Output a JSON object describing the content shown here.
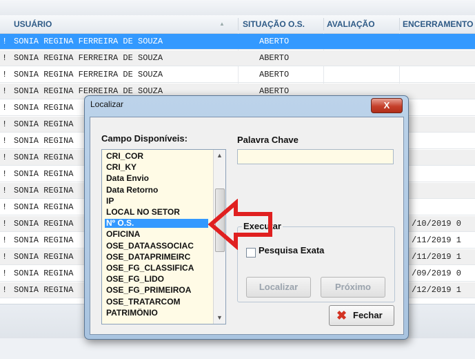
{
  "grid": {
    "columns": {
      "usuario": "USUÁRIO",
      "situacao": "SITUAÇÃO O.S.",
      "avaliacao": "AVALIAÇÃO",
      "encerramento": "ENCERRAMENTO"
    },
    "rows": [
      {
        "edge": "!",
        "usuario": "SONIA REGINA FERREIRA DE SOUZA",
        "situacao": "ABERTO",
        "encerramento": "",
        "selected": true
      },
      {
        "edge": "!",
        "usuario": "SONIA REGINA FERREIRA DE SOUZA",
        "situacao": "ABERTO",
        "encerramento": ""
      },
      {
        "edge": "!",
        "usuario": "SONIA REGINA FERREIRA DE SOUZA",
        "situacao": "ABERTO",
        "encerramento": ""
      },
      {
        "edge": "!",
        "usuario": "SONIA REGINA FERREIRA DE SOUZA",
        "situacao": "ABERTO",
        "encerramento": ""
      },
      {
        "edge": "!",
        "usuario": "SONIA REGINA",
        "situacao": "",
        "encerramento": ""
      },
      {
        "edge": "!",
        "usuario": "SONIA REGINA",
        "situacao": "",
        "encerramento": ""
      },
      {
        "edge": "!",
        "usuario": "SONIA REGINA",
        "situacao": "",
        "encerramento": ""
      },
      {
        "edge": "!",
        "usuario": "SONIA REGINA",
        "situacao": "",
        "encerramento": ""
      },
      {
        "edge": "!",
        "usuario": "SONIA REGINA",
        "situacao": "",
        "encerramento": ""
      },
      {
        "edge": "!",
        "usuario": "SONIA REGINA",
        "situacao": "",
        "encerramento": ""
      },
      {
        "edge": "!",
        "usuario": "SONIA REGINA",
        "situacao": "",
        "encerramento": ""
      },
      {
        "edge": "!",
        "usuario": "SONIA REGINA",
        "situacao": "",
        "encerramento": "/10/2019 0"
      },
      {
        "edge": "!",
        "usuario": "SONIA REGINA",
        "situacao": "",
        "encerramento": "/11/2019 1"
      },
      {
        "edge": "!",
        "usuario": "SONIA REGINA",
        "situacao": "",
        "encerramento": "/11/2019 1"
      },
      {
        "edge": "!",
        "usuario": "SONIA REGINA",
        "situacao": "",
        "encerramento": "/09/2019 0"
      },
      {
        "edge": "!",
        "usuario": "SONIA REGINA",
        "situacao": "",
        "encerramento": "/12/2019 1"
      }
    ]
  },
  "dialog": {
    "title": "Localizar",
    "close_label": "X",
    "campo_label": "Campo Disponíveis:",
    "palavra_label": "Palavra Chave",
    "palavra_value": "",
    "fields": [
      "CRI_COR",
      "CRI_KY",
      "Data Envio",
      "Data Retorno",
      "IP",
      "LOCAL NO SETOR",
      "Nº O.S.",
      "OFICINA",
      "OSE_DATAASSOCIAC",
      "OSE_DATAPRIMEIRC",
      "OSE_FG_CLASSIFICA",
      "OSE_FG_LIDO",
      "OSE_FG_PRIMEIROA",
      "OSE_TRATARCOM",
      "PATRIMÔNIO"
    ],
    "selected_field": "Nº O.S.",
    "group_label": "Executar",
    "pesquisa_label": "Pesquisa Exata",
    "pesquisa_checked": false,
    "localizar_label": "Localizar",
    "proximo_label": "Próximo",
    "fechar_label": "Fechar",
    "scroll_up": "▲",
    "scroll_down": "▼"
  },
  "colors": {
    "selection": "#3399ff",
    "annotation_arrow": "#e02020",
    "close_button": "#c5402b"
  }
}
